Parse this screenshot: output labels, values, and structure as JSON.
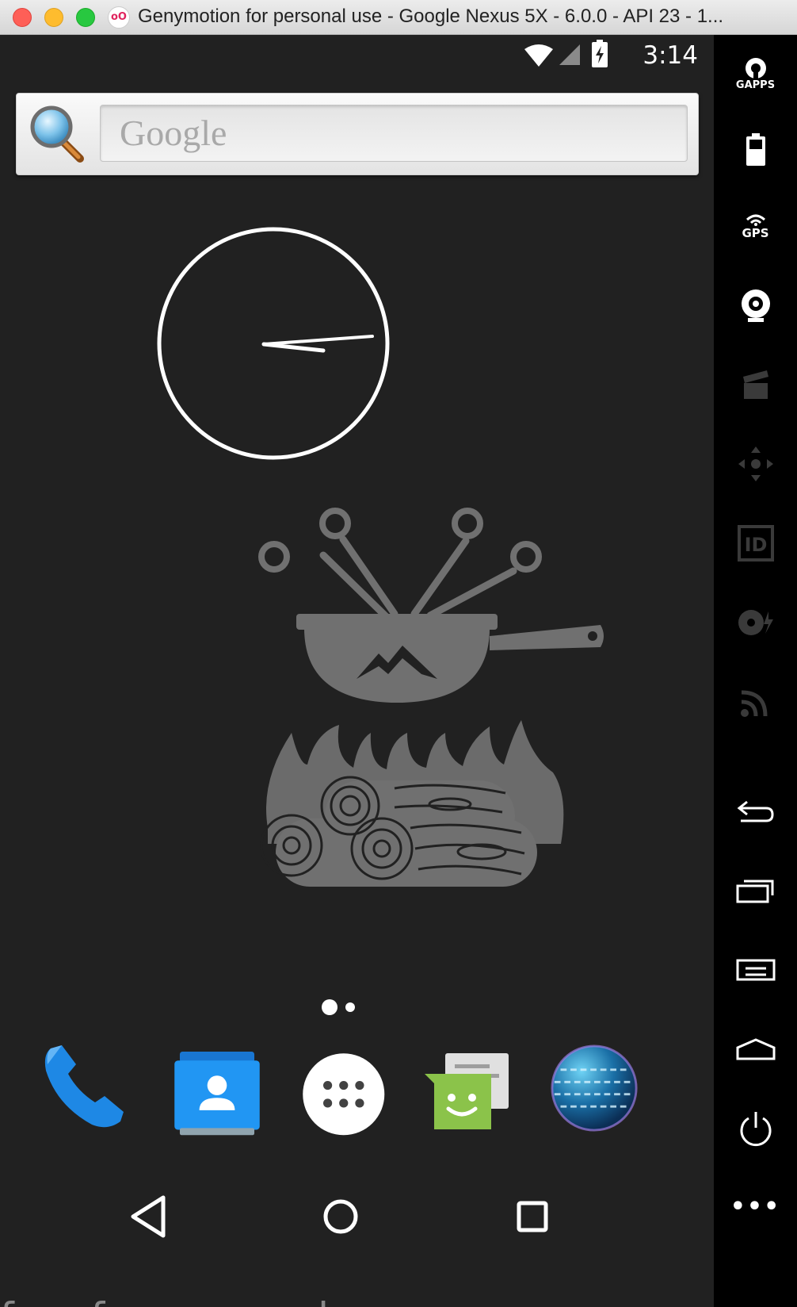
{
  "window": {
    "title": "Genymotion for personal use - Google Nexus 5X - 6.0.0 - API 23 - 1...",
    "app_icon": "oO"
  },
  "status_bar": {
    "time": "3:14",
    "icons": [
      "wifi-icon",
      "signal-icon",
      "battery-charging-icon"
    ]
  },
  "search_widget": {
    "placeholder_logo": "Google",
    "icon": "magnifier-icon"
  },
  "clock": {
    "hour": 3,
    "minute": 14
  },
  "wallpaper": {
    "art": "fondue-pot-over-campfire"
  },
  "page_indicator": {
    "pages": 2,
    "active": 0
  },
  "dock": {
    "apps": [
      "Phone",
      "Contacts",
      "All apps",
      "Messaging",
      "Browser"
    ]
  },
  "navigation_bar": {
    "buttons": [
      "back",
      "home",
      "recents"
    ]
  },
  "sidebar": {
    "gapps_label": "GAPPS",
    "gps_label": "GPS",
    "id_label": "ID",
    "more_label": "•••"
  },
  "watermark": "free for personal use",
  "colors": {
    "screen_bg": "#212121",
    "toolbar_bg": "#000000",
    "wallpaper_art": "#707070",
    "phone_blue": "#1e88e5",
    "contacts_blue": "#2196f3",
    "messaging_green": "#8bc34a"
  }
}
